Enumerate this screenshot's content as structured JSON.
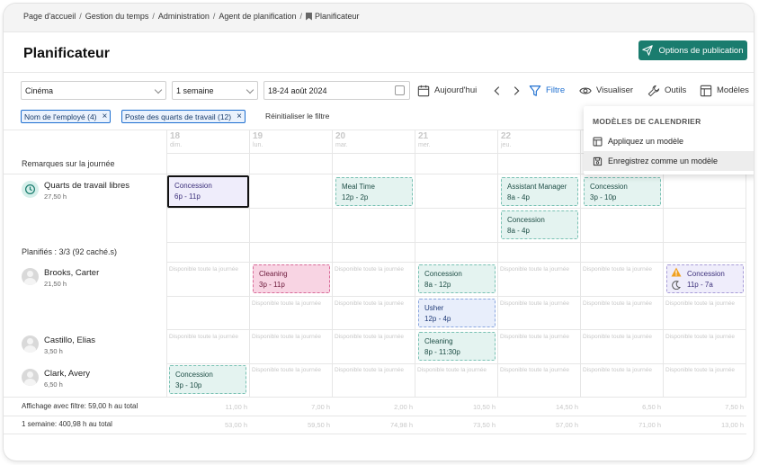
{
  "breadcrumb": [
    "Page d'accueil",
    "Gestion du temps",
    "Administration",
    "Agent de planification",
    "Planificateur"
  ],
  "page_title": "Planificateur",
  "publish_button": "Options de publication",
  "toolbar": {
    "location": "Cinéma",
    "range": "1 semaine",
    "date_range": "18-24 août 2024",
    "today": "Aujourd'hui",
    "filter": "Filtre",
    "view": "Visualiser",
    "tools": "Outils",
    "templates": "Modèles"
  },
  "chips": [
    "Nom de l'employé (4)",
    "Poste des quarts de travail (12)"
  ],
  "reset_filter": "Réinitialiser le filtre",
  "days": [
    {
      "num": "18",
      "name": "dim."
    },
    {
      "num": "19",
      "name": "lun."
    },
    {
      "num": "20",
      "name": "mar."
    },
    {
      "num": "21",
      "name": "mer."
    },
    {
      "num": "22",
      "name": "jeu."
    }
  ],
  "daily_notes_label": "Remarques sur la journée",
  "open_shifts": {
    "name": "Quarts de travail libres",
    "hours": "27,50 h"
  },
  "scheduled_label": "Planifiés : 3/3 (92 caché.s)",
  "employees": [
    {
      "name": "Brooks, Carter",
      "hours": "21,50 h"
    },
    {
      "name": "Castillo, Elias",
      "hours": "3,50 h"
    },
    {
      "name": "Clark, Avery",
      "hours": "6,50 h"
    }
  ],
  "shifts": [
    {
      "title": "Concession",
      "time": "6p - 11p"
    },
    {
      "title": "Meal Time",
      "time": "12p - 2p"
    },
    {
      "title": "Assistant Manager",
      "time": "8a - 4p"
    },
    {
      "title": "Concession",
      "time": "3p - 10p"
    },
    {
      "title": "Concession",
      "time": "8a - 4p"
    },
    {
      "title": "Cleaning",
      "time": "3p - 11p"
    },
    {
      "title": "Concession",
      "time": "8a - 12p"
    },
    {
      "title": "Concession",
      "time": "11p - 7a"
    },
    {
      "title": "Usher",
      "time": "12p - 4p"
    },
    {
      "title": "Cleaning",
      "time": "8p - 11:30p"
    },
    {
      "title": "Concession",
      "time": "3p - 10p"
    }
  ],
  "available_text": "Disponible toute la journée",
  "footer": {
    "filtered_label": "Affichage avec filtre: 59,00 h au total",
    "filtered_totals": [
      "11,00 h",
      "7,00 h",
      "2,00 h",
      "10,50 h",
      "14,50 h",
      "6,50 h",
      "7,50 h"
    ],
    "week_label": "1 semaine: 400,98 h au total",
    "week_totals": [
      "53,00 h",
      "59,50 h",
      "74,98 h",
      "73,50 h",
      "57,00 h",
      "71,00 h",
      "13,00 h"
    ]
  },
  "templates_menu": {
    "header": "MODÈLES DE CALENDRIER",
    "items": [
      "Appliquez un modèle",
      "Enregistrez comme un modèle"
    ]
  },
  "colors": {
    "accent": "#1a7c6e",
    "filter_blue": "#1e6fd0"
  }
}
